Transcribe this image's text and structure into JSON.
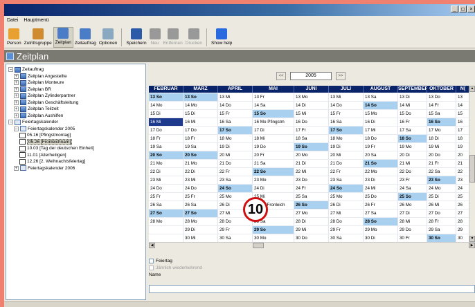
{
  "menu": {
    "items": [
      "Datei",
      "Hauptmenü"
    ]
  },
  "toolbar": {
    "buttons": [
      {
        "label": "Person",
        "icon": "person-icon",
        "color": "#e8a030"
      },
      {
        "label": "Zutrittsgruppe",
        "icon": "group-icon",
        "color": "#d08a30"
      },
      {
        "label": "Zeitplan",
        "icon": "schedule-icon",
        "color": "#4a7cc8"
      },
      {
        "label": "Zeitauftrag",
        "icon": "timejob-icon",
        "color": "#4a7cc8"
      },
      {
        "label": "Optionen",
        "icon": "options-icon",
        "color": "#8aa8c0"
      },
      {
        "label": "Speichern",
        "icon": "save-icon",
        "color": "#2a5aa8"
      },
      {
        "label": "Neu",
        "icon": "plus-icon",
        "color": "#999999"
      },
      {
        "label": "Entfernen",
        "icon": "remove-icon",
        "color": "#999999"
      },
      {
        "label": "Drucken",
        "icon": "print-icon",
        "color": "#999999"
      },
      {
        "label": "Show help",
        "icon": "help-icon",
        "color": "#2a6ae0"
      }
    ]
  },
  "header": {
    "title": "Zeitplan"
  },
  "tree": [
    {
      "label": "Zeitauftrag",
      "expander": "−",
      "kind": "group",
      "level": 0
    },
    {
      "label": "Zeitplan Angestellte",
      "expander": "+",
      "kind": "group",
      "level": 1
    },
    {
      "label": "Zeitplan Monteure",
      "expander": "+",
      "kind": "group",
      "level": 1
    },
    {
      "label": "Zeitplan BR",
      "expander": "+",
      "kind": "group",
      "level": 1
    },
    {
      "label": "Zeitplan Zylinderpartner",
      "expander": "+",
      "kind": "group",
      "level": 1
    },
    {
      "label": "Zeitplan Geschäftsleitung",
      "expander": "+",
      "kind": "group",
      "level": 1
    },
    {
      "label": "Zeitplan Teilzeit",
      "expander": "+",
      "kind": "group",
      "level": 1
    },
    {
      "label": "Zeitplan Aushilfen",
      "expander": "+",
      "kind": "group",
      "level": 1
    },
    {
      "label": "Feiertagskalender",
      "expander": "−",
      "kind": "cal",
      "level": 0
    },
    {
      "label": "Feiertagskalender 2005",
      "expander": "−",
      "kind": "cal",
      "level": 1
    },
    {
      "label": "05.16 [Pfingstmontag]",
      "expander": "",
      "kind": "day",
      "level": 2
    },
    {
      "label": "05.26 [Fronleichnam]",
      "expander": "",
      "kind": "day",
      "level": 2,
      "selected": true
    },
    {
      "label": "10.03 [Tag der deutschen Einheit]",
      "expander": "",
      "kind": "day",
      "level": 2
    },
    {
      "label": "11.01 [Allerheiligen]",
      "expander": "",
      "kind": "day",
      "level": 2
    },
    {
      "label": "12.26 [2. Weihnachtsfeiertag]",
      "expander": "",
      "kind": "day",
      "level": 2
    },
    {
      "label": "Feiertagskalender 2006",
      "expander": "+",
      "kind": "cal",
      "level": 1
    }
  ],
  "calendar": {
    "year": "2005",
    "prev": "<<",
    "next": ">>",
    "months": [
      "FEBRUAR",
      "MÄRZ",
      "APRIL",
      "MAI",
      "JUNI",
      "JULI",
      "AUGUST",
      "SEPTEMBER",
      "OKTOBER",
      "N("
    ],
    "rows": [
      [
        "13 So",
        "13 So",
        "13 Mi",
        "13 Fr",
        "13 Mo",
        "13 Mi",
        "13 Sa",
        "13 Di",
        "13 Do",
        "13"
      ],
      [
        "14 Mo",
        "14 Mo",
        "14 Do",
        "14 Sa",
        "14 Di",
        "14 Do",
        "14 So",
        "14 Mi",
        "14 Fr",
        "14"
      ],
      [
        "15 Di",
        "15 Di",
        "15 Fr",
        "15 So",
        "15 Mi",
        "15 Fr",
        "15 Mo",
        "15 Do",
        "15 Sa",
        "15"
      ],
      [
        "16 Mi",
        "16 Mi",
        "16 Sa",
        "16 Mo Pfingstm",
        "16 Do",
        "16 Sa",
        "16 Di",
        "16 Fr",
        "16 So",
        "16"
      ],
      [
        "17 Do",
        "17 Do",
        "17 So",
        "17 Di",
        "17 Fr",
        "17 So",
        "17 Mi",
        "17 Sa",
        "17 Mo",
        "17"
      ],
      [
        "18 Fr",
        "18 Fr",
        "18 Mo",
        "18 Mi",
        "18 Sa",
        "18 Mo",
        "18 Do",
        "18 So",
        "18 Di",
        "18"
      ],
      [
        "19 Sa",
        "19 Sa",
        "19 Di",
        "19 Do",
        "19 So",
        "19 Di",
        "19 Fr",
        "19 Mo",
        "19 Mi",
        "19"
      ],
      [
        "20 So",
        "20 So",
        "20 Mi",
        "20 Fr",
        "20 Mo",
        "20 Mi",
        "20 Sa",
        "20 Di",
        "20 Do",
        "20"
      ],
      [
        "21 Mo",
        "21 Mo",
        "21 Do",
        "21 Sa",
        "21 Di",
        "21 Do",
        "21 So",
        "21 Mi",
        "21 Fr",
        "21"
      ],
      [
        "22 Di",
        "22 Di",
        "22 Fr",
        "22 So",
        "22 Mi",
        "22 Fr",
        "22 Mo",
        "22 Do",
        "22 Sa",
        "22"
      ],
      [
        "23 Mi",
        "23 Mi",
        "23 Sa",
        "23 Mo",
        "23 Do",
        "23 Sa",
        "23 Di",
        "23 Fr",
        "23 So",
        "23"
      ],
      [
        "24 Do",
        "24 Do",
        "24 So",
        "24 Di",
        "24 Fr",
        "24 So",
        "24 Mi",
        "24 Sa",
        "24 Mo",
        "24"
      ],
      [
        "25 Fr",
        "25 Fr",
        "25 Mo",
        "25 Mi",
        "25 Sa",
        "25 Mo",
        "25 Do",
        "25 So",
        "25 Di",
        "25"
      ],
      [
        "26 Sa",
        "26 Sa",
        "26 Di",
        "26 Do Fronleich",
        "26 So",
        "26 Di",
        "26 Fr",
        "26 Mo",
        "26 Mi",
        "26"
      ],
      [
        "27 So",
        "27 So",
        "27 Mi",
        "27 Fr",
        "27 Mo",
        "27 Mi",
        "27 Sa",
        "27 Di",
        "27 Do",
        "27"
      ],
      [
        "28 Mo",
        "28 Mo",
        "28 Do",
        "28 Sa",
        "28 Di",
        "28 Do",
        "28 So",
        "28 Mi",
        "28 Fr",
        "28"
      ],
      [
        "",
        "29 Di",
        "29 Fr",
        "29 So",
        "29 Mi",
        "29 Fr",
        "29 Mo",
        "29 Do",
        "29 Sa",
        "29"
      ],
      [
        "",
        "30 Mi",
        "30 Sa",
        "30 Mo",
        "30 Do",
        "30 Sa",
        "30 Di",
        "30 Fr",
        "30 So",
        "30"
      ]
    ],
    "highlighted": {
      "row": 3,
      "col": 0
    },
    "badge": "10"
  },
  "options": {
    "feiertag": "Feiertag",
    "jaehrlich": "Jährlich wiederkehrend",
    "name_label": "Name",
    "name_value": ""
  },
  "window_buttons": [
    "_",
    "□",
    "×"
  ]
}
